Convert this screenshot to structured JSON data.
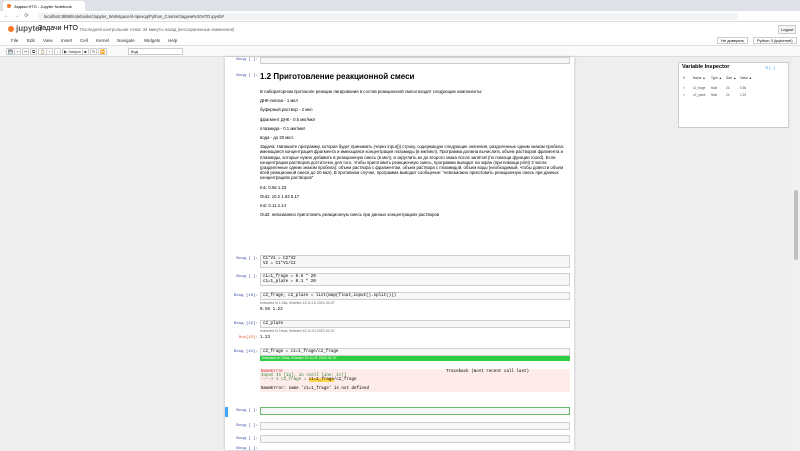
{
  "browser": {
    "tab_title": "Задачи НТО - Jupyter Notebook",
    "url": "localhost:8888/notebooks/Jupyter_Workspace/4-преход/Python_Course/Задачи%20НТО.ipynb#",
    "back": "←",
    "forward": "→",
    "reload": "⟳"
  },
  "header": {
    "logo": "jupyter",
    "notebook_title": "Задачи НТО",
    "save_info": "Последняя контрольная точка: 34 минуты назад  (несохраненные изменения)",
    "logout": "Logout"
  },
  "menubar": {
    "items": [
      "File",
      "Edit",
      "View",
      "Insert",
      "Cell",
      "Kernel",
      "Navigate",
      "Widgets",
      "Help"
    ],
    "trusted": "Не доверять",
    "kernel": "Python 3 (ipykernel)"
  },
  "toolbar": {
    "buttons": [
      "💾",
      "+",
      "✂",
      "⧉",
      "📋",
      "↑",
      "↓",
      "▶ Запуск",
      "■",
      "↻",
      "⏩"
    ],
    "cell_type": "Код"
  },
  "notebook": {
    "top_prompt": "Вход [ ]:",
    "md_title": "1.2  Приготовление реакционной смеси",
    "md_paragraphs": [
      "В лабораторном протоколе реакции лигирования в состав реакционной смеси входят следующие компоненты:",
      "ДНК-лигаза - 1 мкл",
      "буферный раствор - 2 мкл",
      "фрагмент ДНК - 0.5 мкг/мкл",
      "плазмида - 0.1 мкг/мкл",
      "вода - до 20 мкл.",
      "Задача: Напишите программу, которая будет принимать (через input()) строку, содержащую следующие значения, разделенные одним знаком пробела: имеющаяся концентрация фрагмента и имеющаяся концентрация плазмиды (в мкг/мкл). Программа должна вычислить объем растворов фрагмента и плазмиды, которые нужно добавить в реакционную смесь (в мкл), и округлить их до второго знака после запятой (по помощи функции round). Если концентрации растворов достаточно для того, чтобы приготовить реакционную смесь, программа выводит на экран (при помощи print) 3 числа (разделенные одним знаком пробела): объем раствора с фрагментом, объем раствора с плазмидой, объем воды (необходимый, чтобы довести объем всей реакционной смеси до 20 мкл). В противном случае, программа выводит сообщение: \"невозможно приготовить реакционную смесь при данных концентрациях растворов\"",
      "In1: 0.56 1.23",
      "Out1: 10.2 1.63 5.17",
      "In2: 0.11 2.14",
      "Out2: невозможно приготовить реакционную смесь при данных концентрациях растворов"
    ],
    "cells": [
      {
        "prompt": "Вход [ ]:",
        "code": "C1*V1 = C2*V2\nV2 = C1*V1/C2",
        "exec": "",
        "out_prompt": "",
        "output": ""
      },
      {
        "prompt": "Вход [ ]:",
        "code": "c1=1_frage = 0.5 * 20\nc1=1_plaze = 0.1 * 20",
        "exec": "",
        "out_prompt": "",
        "output": ""
      },
      {
        "prompt": "Вход [10]:",
        "code": "c2_frage, c2_plaze = list(map(float,input().split()))",
        "exec": "executed in 1.06s, finished 12:11:16 2022-02-07",
        "out_prompt": "",
        "output": "0.56 1.23"
      },
      {
        "prompt": "Вход [22]:",
        "code": "c2_plaze",
        "exec": "executed in 10ms, finished 12:11:24 2022-02-07",
        "out_prompt": "Out[22]:",
        "output": "1.23"
      }
    ],
    "error_cell": {
      "prompt": "Вход [21]:",
      "code": "c2_frage = c1=1_frage/c2_frage",
      "exec": "executed in 15ms, finished 12:11:21 2022-02-07",
      "err_name": "NameError",
      "traceback_hdr": "Traceback (most recent call last)",
      "input_line": "Input In [21], in <cell line: 1>()",
      "arrow_line": "----> 1 c2_frage = ",
      "arrow_hl": "c1=1_frage",
      "arrow_tail": "/c2_frage",
      "message": "NameError: name 'c1=1_frage' is not defined"
    },
    "empty_prompts": [
      "Вход [ ]:",
      "Вход [ ]:",
      "Вход [ ]:",
      "Вход [ ]:"
    ]
  },
  "variable_inspector": {
    "title": "Variable Inspector",
    "buttons": "⟲ [ - ]",
    "columns": [
      "X",
      "Name ▲",
      "Type ▲",
      "Size ▲",
      "Value ▲"
    ],
    "rows": [
      [
        "×",
        "c2_frage",
        "float",
        "24",
        "0.56"
      ],
      [
        "×",
        "c2_plaze",
        "float",
        "24",
        "1.23"
      ]
    ]
  }
}
